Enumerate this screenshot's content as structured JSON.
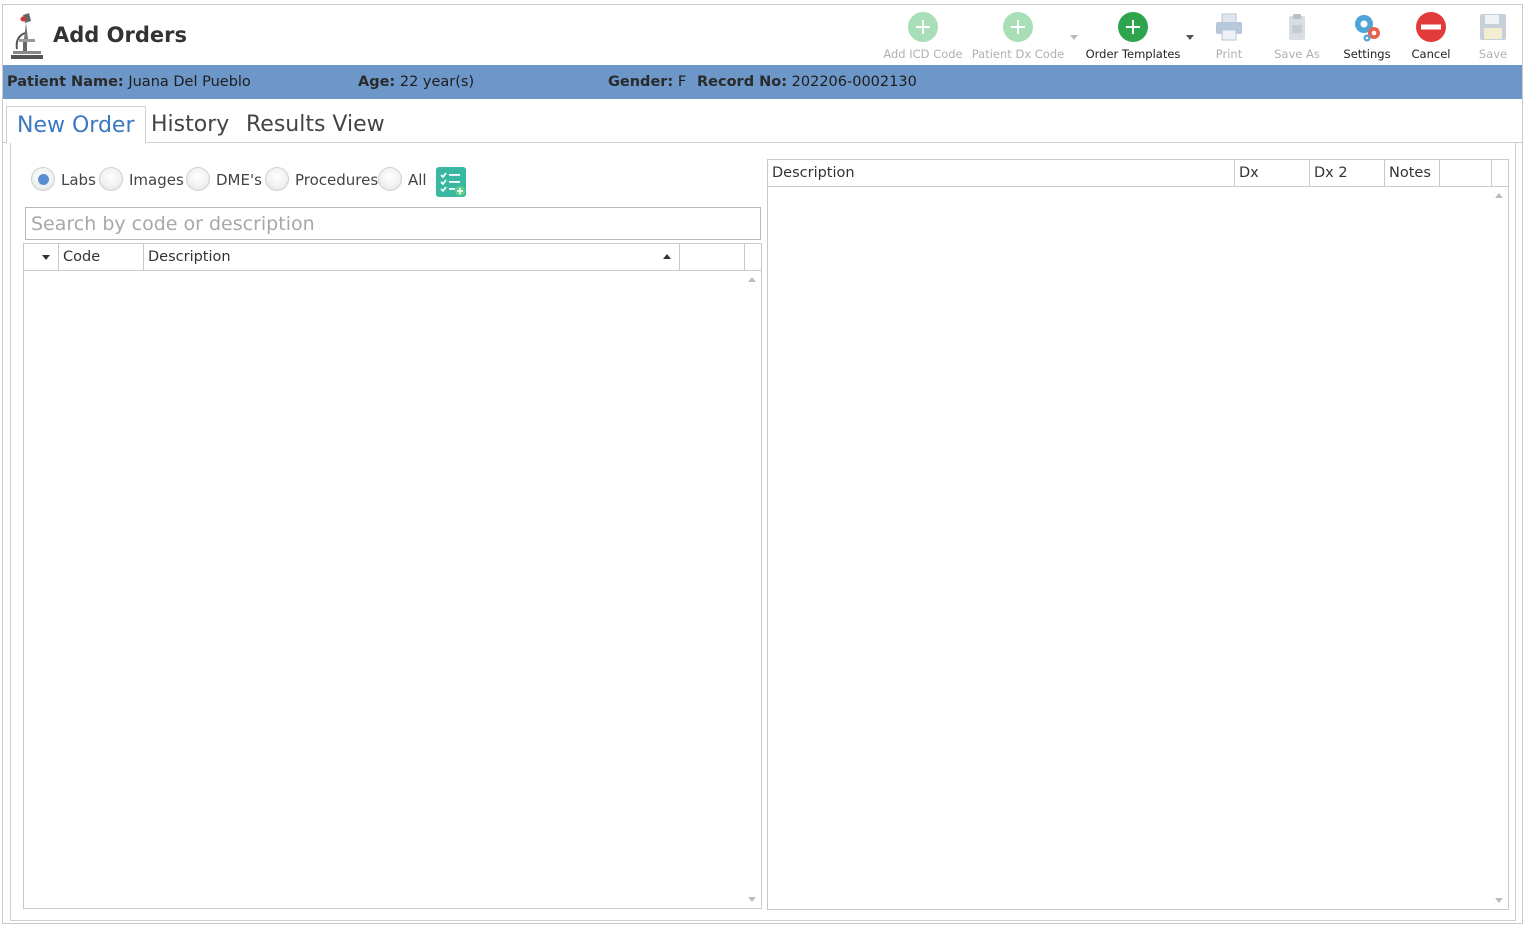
{
  "window": {
    "title": "Add Orders",
    "app_icon": "microscope-icon"
  },
  "toolbar": {
    "add_icd_code": "Add ICD Code",
    "patient_dx_code": "Patient Dx Code",
    "order_templates": "Order Templates",
    "print": "Print",
    "save_as": "Save As",
    "settings": "Settings",
    "cancel": "Cancel",
    "save": "Save"
  },
  "patient": {
    "name_label": "Patient Name:",
    "name": "Juana Del Pueblo",
    "age_label": "Age:",
    "age": "22 year(s)",
    "gender_label": "Gender:",
    "gender": "F",
    "record_label": "Record No:",
    "record": "202206-0002130"
  },
  "tabs": [
    "New Order",
    "History",
    "Results View"
  ],
  "active_tab": "New Order",
  "filters": {
    "options": [
      "Labs",
      "Images",
      "DME's",
      "Procedures",
      "All"
    ],
    "selected": "Labs"
  },
  "search": {
    "placeholder": "Search by code or description",
    "value": ""
  },
  "left_grid": {
    "columns": [
      "",
      "Code",
      "Description",
      ""
    ],
    "rows": []
  },
  "right_grid": {
    "columns": [
      "Description",
      "Dx",
      "Dx 2",
      "Notes",
      ""
    ],
    "rows": []
  },
  "colors": {
    "patient_bar": "#6d97c8",
    "active_tab": "#3a78c2",
    "accent_green": "#2ea44f",
    "cancel_red": "#e23b3b"
  }
}
